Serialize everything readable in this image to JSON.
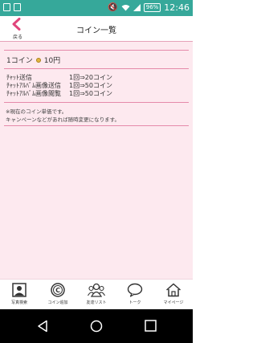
{
  "status_bar": {
    "battery": "96%",
    "time": "12:46"
  },
  "header": {
    "back_label": "戻る",
    "title": "コイン一覧"
  },
  "coin_rate": {
    "label": "1コイン",
    "price": "10円"
  },
  "price_list": [
    {
      "name": "ﾁｬｯﾄ送信",
      "value": "1回⇒20コイン"
    },
    {
      "name": "ﾁｬｯﾄｱﾙﾊﾞﾑ画像送信",
      "value": "1回⇒50コイン"
    },
    {
      "name": "ﾁｬｯﾄｱﾙﾊﾞﾑ画像閲覧",
      "value": "1回⇒50コイン"
    }
  ],
  "notes": [
    "※現在のコイン単価です。",
    "キャンペーンなどがあれば随時変更になります。"
  ],
  "tabs": [
    {
      "label": "写真検索",
      "icon": "photo-search-icon"
    },
    {
      "label": "コイン追加",
      "icon": "coin-add-icon"
    },
    {
      "label": "友達リスト",
      "icon": "friends-list-icon"
    },
    {
      "label": "トーク",
      "icon": "talk-icon"
    },
    {
      "label": "マイページ",
      "icon": "my-page-icon"
    }
  ],
  "colors": {
    "accent": "#e0457b",
    "status_bar": "#36a89a",
    "content_bg": "#fde9ef"
  }
}
